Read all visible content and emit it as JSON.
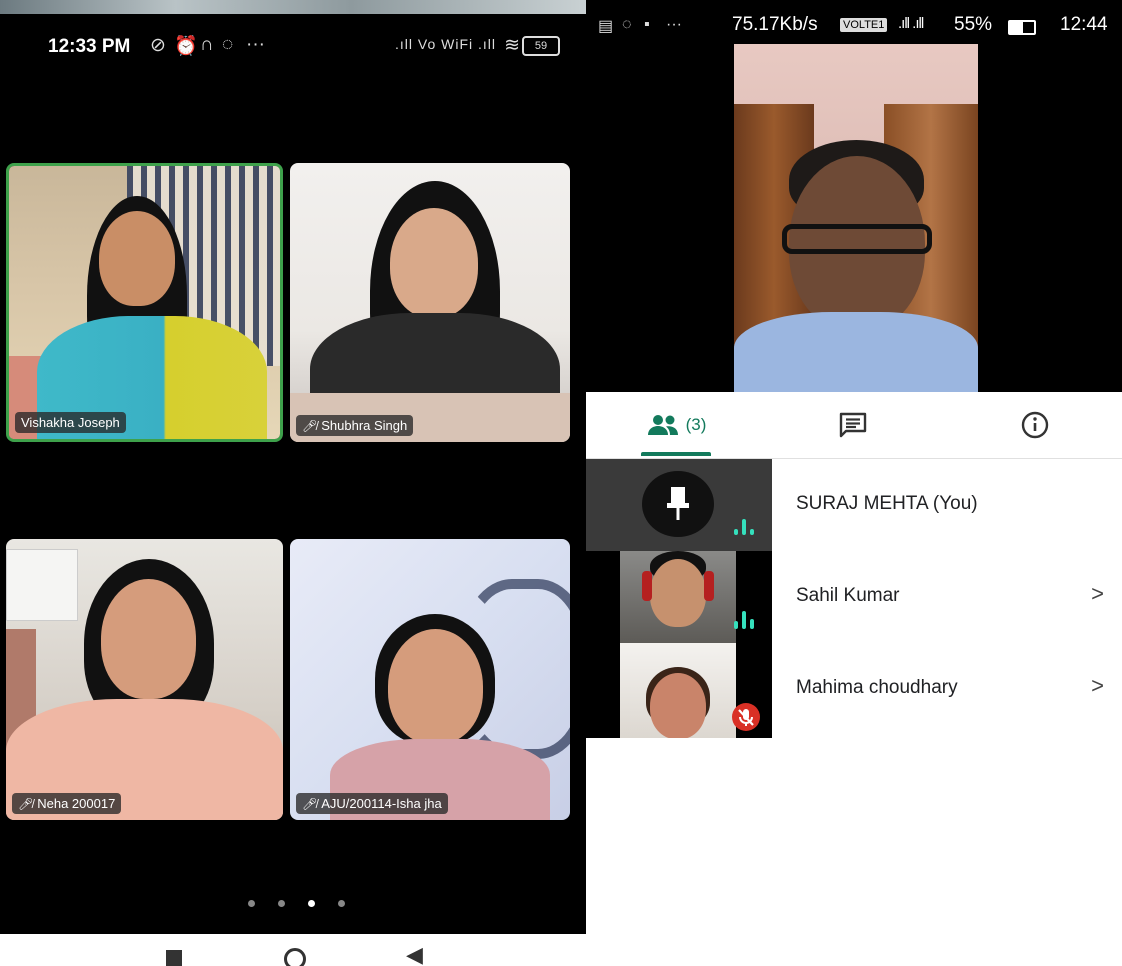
{
  "left_phone": {
    "status": {
      "time": "12:33 PM",
      "icons": [
        "blocked-notification-icon",
        "alarm-icon",
        "headset-icon",
        "whatsapp-icon",
        "more-icon"
      ],
      "net_label": ".ıll Vo WiFi .ıll",
      "battery": "59"
    },
    "tiles": [
      {
        "name": "Vishakha Joseph",
        "muted": false,
        "active_speaker": true
      },
      {
        "name": "Shubhra Singh",
        "muted": true
      },
      {
        "name": "Neha 200017",
        "muted": true
      },
      {
        "name": "AJU/200114-Isha jha",
        "muted": true
      }
    ],
    "page_dots": {
      "count": 4,
      "active_index": 2
    },
    "nav": [
      "stop-square-icon",
      "home-circle-icon",
      "back-triangle-icon"
    ]
  },
  "right_phone": {
    "status": {
      "icons": [
        "message-icon",
        "whatsapp-icon",
        "image-icon",
        "more-icon"
      ],
      "speed": "75.17Kb/s",
      "volte": "VOLTE1",
      "battery": "55%",
      "time": "12:44"
    },
    "tabs": [
      {
        "icon": "people-icon",
        "label": "(3)",
        "selected": true
      },
      {
        "icon": "chat-icon",
        "label": ""
      },
      {
        "icon": "info-icon",
        "label": ""
      }
    ],
    "participants": [
      {
        "name": "SURAJ MEHTA (You)",
        "speaking": true,
        "muted": false,
        "chevron": false
      },
      {
        "name": "Sahil Kumar",
        "speaking": true,
        "muted": false,
        "chevron": true
      },
      {
        "name": "Mahima choudhary",
        "speaking": false,
        "muted": true,
        "chevron": true
      }
    ],
    "chevron_glyph": ">"
  },
  "colors": {
    "accent_green": "#137a5c",
    "active_border": "#3ea14b",
    "speaking": "#35e0bd",
    "muted_red": "#d93025"
  }
}
